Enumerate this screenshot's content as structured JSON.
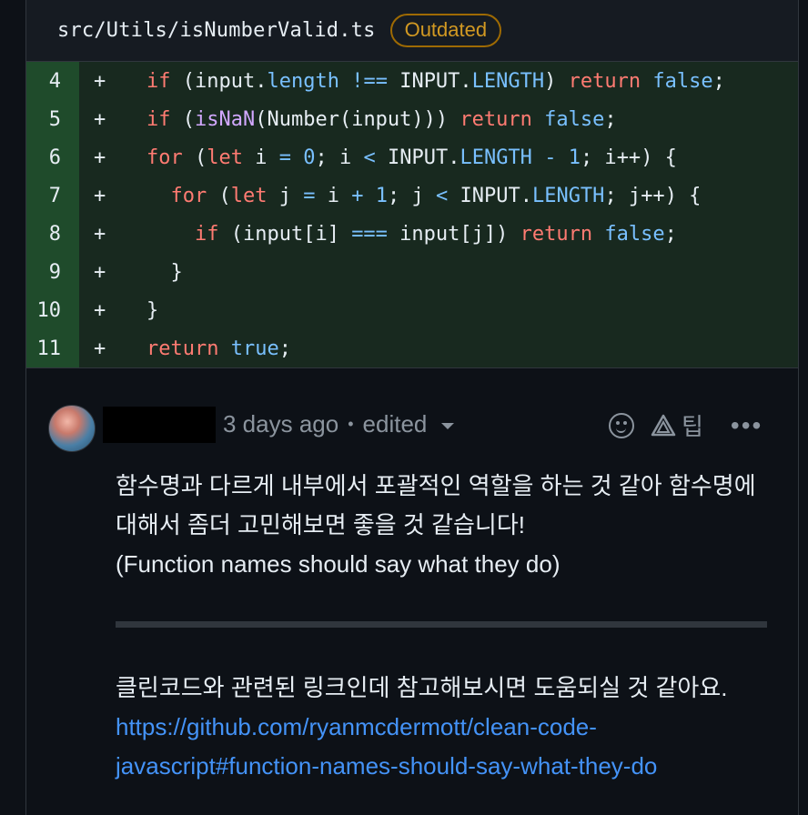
{
  "file": {
    "path": "src/Utils/isNumberValid.ts",
    "badge": "Outdated"
  },
  "diff_lines": [
    {
      "num": "4",
      "marker": "+"
    },
    {
      "num": "5",
      "marker": "+"
    },
    {
      "num": "6",
      "marker": "+"
    },
    {
      "num": "7",
      "marker": "+"
    },
    {
      "num": "8",
      "marker": "+"
    },
    {
      "num": "9",
      "marker": "+"
    },
    {
      "num": "10",
      "marker": "+"
    },
    {
      "num": "11",
      "marker": "+"
    }
  ],
  "code": {
    "l4": [
      "if",
      " (input.",
      "length",
      " ",
      "!==",
      " INPUT.",
      "LENGTH",
      ") ",
      "return",
      " ",
      "false",
      ";"
    ],
    "l5": [
      "if",
      " (",
      "isNaN",
      "(Number(input))) ",
      "return",
      " ",
      "false",
      ";"
    ],
    "l6": [
      "for",
      " (",
      "let",
      " i ",
      "=",
      " ",
      "0",
      "; i ",
      "<",
      " INPUT.",
      "LENGTH",
      " ",
      "-",
      " ",
      "1",
      "; i",
      "++",
      ") {"
    ],
    "l7": [
      "  ",
      "for",
      " (",
      "let",
      " j ",
      "=",
      " i ",
      "+",
      " ",
      "1",
      "; j ",
      "<",
      " INPUT.",
      "LENGTH",
      "; j",
      "++",
      ") {"
    ],
    "l8": [
      "    ",
      "if",
      " (input[i] ",
      "===",
      " input[j]) ",
      "return",
      " ",
      "false",
      ";"
    ],
    "l9": [
      "  }"
    ],
    "l10": [
      "}"
    ],
    "l11": [
      "return",
      " ",
      "true",
      ";"
    ]
  },
  "comment": {
    "timestamp": "3 days ago",
    "separator": "•",
    "edited": "edited",
    "tip_label": "팁",
    "more": "•••",
    "paragraph1_line1": "함수명과 다르게 내부에서 포괄적인 역할을 하는 것 같아 함수명에",
    "paragraph1_line2": "대해서 좀더 고민해보면 좋을 것 같습니다!",
    "paragraph1_line3": "(Function names should say what they do)",
    "paragraph2": "클린코드와 관련된 링크인데 참고해보시면 도움되실 것 같아요.",
    "link_line1": "https://github.com/ryanmcdermott/clean-code-",
    "link_line2": "javascript#function-names-should-say-what-they-do"
  }
}
